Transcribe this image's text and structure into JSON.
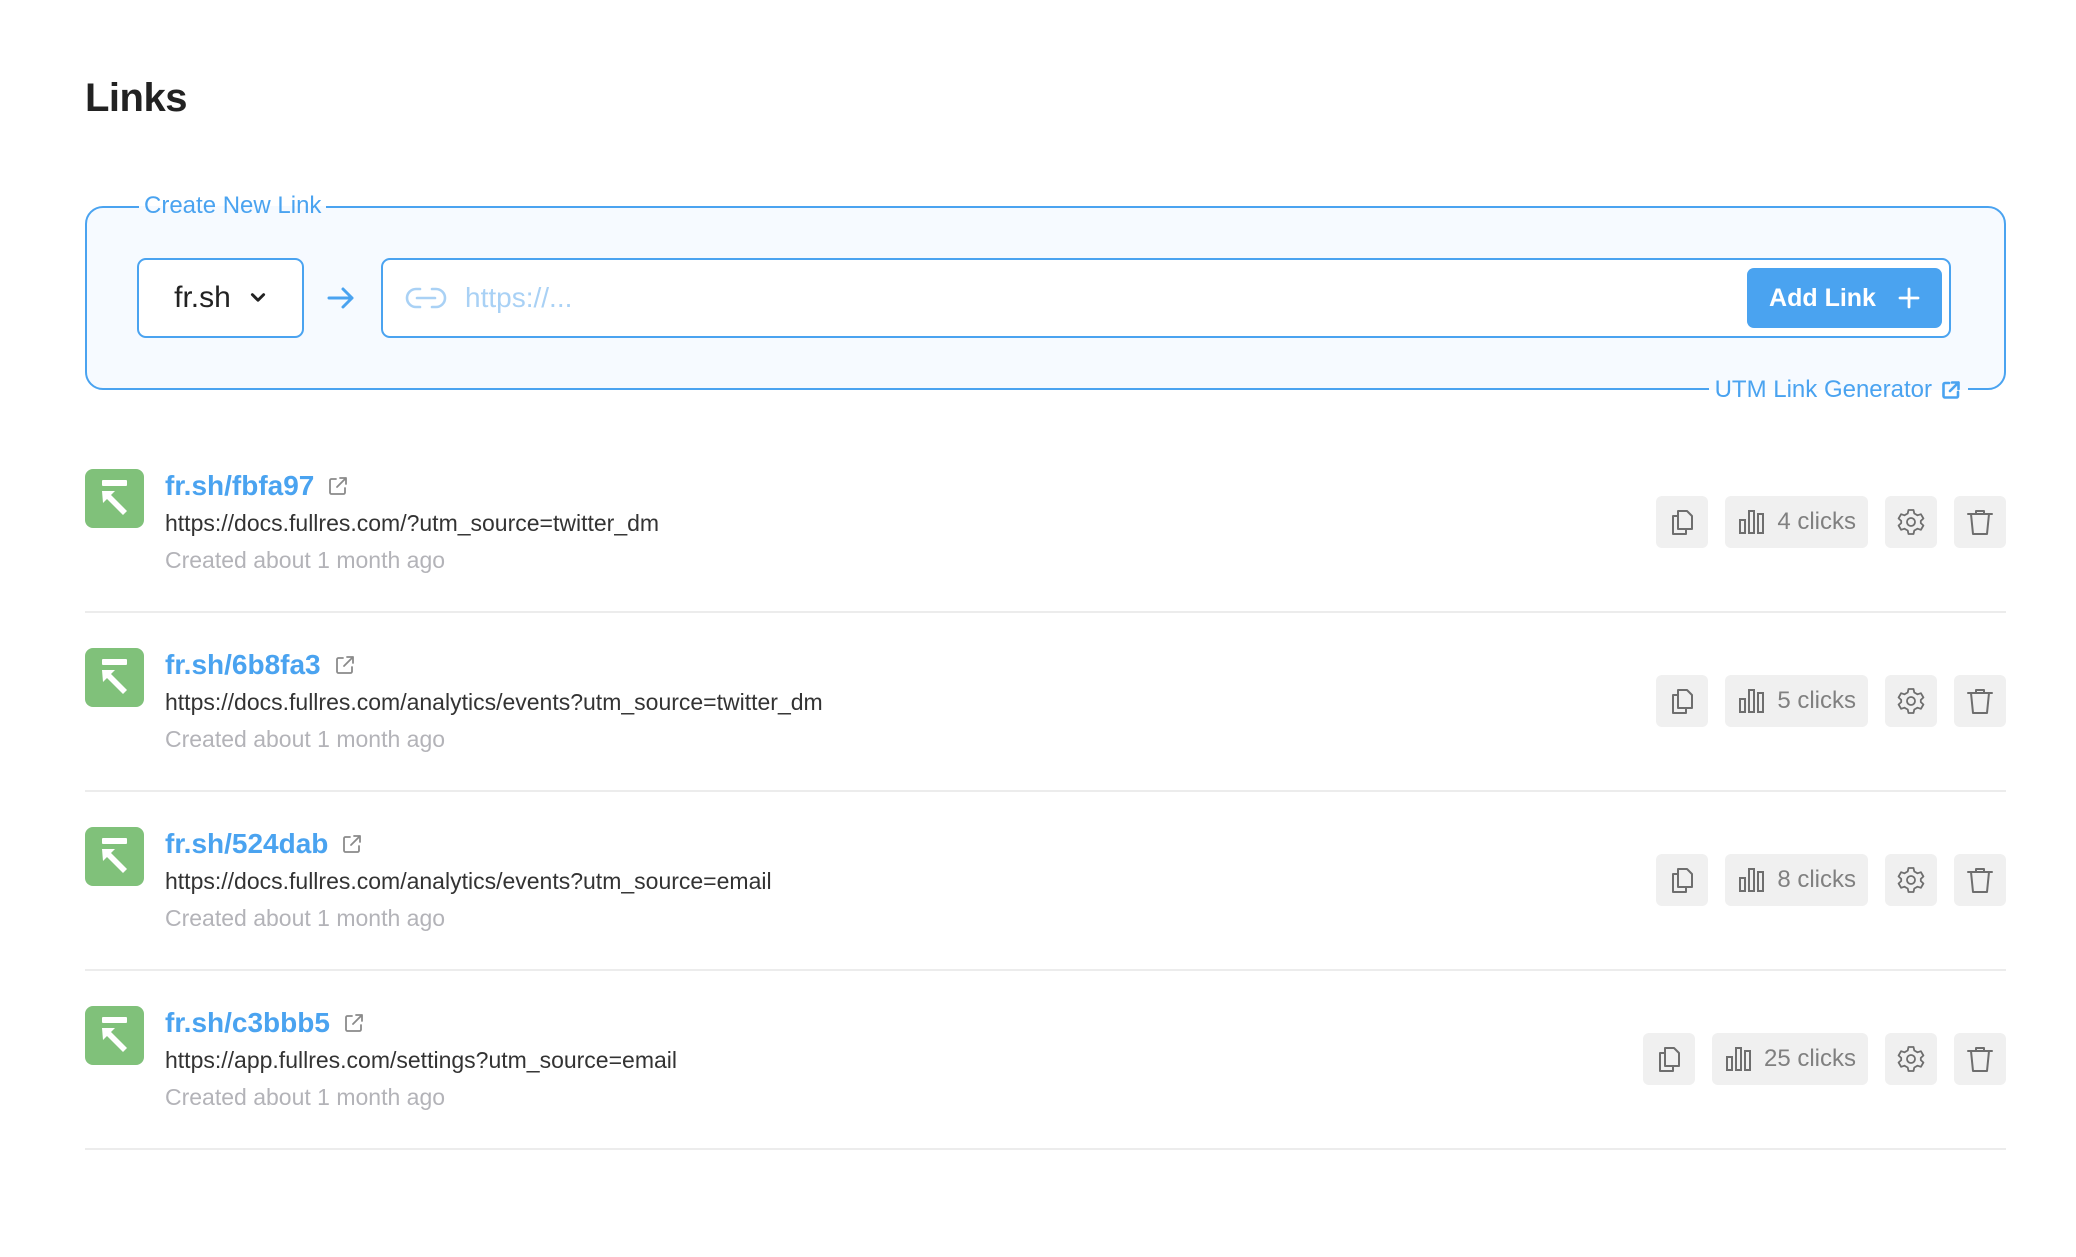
{
  "page": {
    "title": "Links"
  },
  "create": {
    "legend": "Create New Link",
    "domain_select": {
      "value": "fr.sh"
    },
    "url_input": {
      "placeholder": "https://...",
      "value": ""
    },
    "add_button": {
      "label": "Add Link"
    },
    "utm_link": {
      "label": "UTM Link Generator"
    }
  },
  "colors": {
    "accent": "#4aa3f0",
    "logo_bg": "#80c17a",
    "action_bg": "#f0f0f0"
  },
  "links": [
    {
      "short": "fr.sh/fbfa97",
      "destination": "https://docs.fullres.com/?utm_source=twitter_dm",
      "created": "Created about 1 month ago",
      "clicks": "4 clicks"
    },
    {
      "short": "fr.sh/6b8fa3",
      "destination": "https://docs.fullres.com/analytics/events?utm_source=twitter_dm",
      "created": "Created about 1 month ago",
      "clicks": "5 clicks"
    },
    {
      "short": "fr.sh/524dab",
      "destination": "https://docs.fullres.com/analytics/events?utm_source=email",
      "created": "Created about 1 month ago",
      "clicks": "8 clicks"
    },
    {
      "short": "fr.sh/c3bbb5",
      "destination": "https://app.fullres.com/settings?utm_source=email",
      "created": "Created about 1 month ago",
      "clicks": "25 clicks"
    }
  ]
}
